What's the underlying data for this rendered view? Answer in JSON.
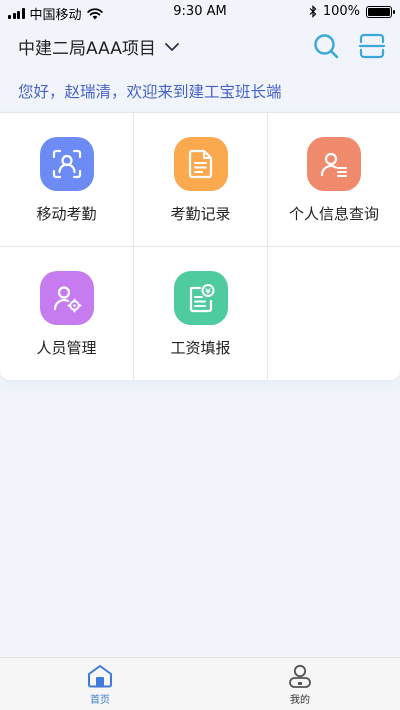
{
  "status_bar": {
    "carrier": "中国移动",
    "time": "9:30 AM",
    "battery": "100%"
  },
  "header": {
    "project": "中建二局AAA项目",
    "icons": [
      "search-icon",
      "scan-icon",
      "chevron-down-icon"
    ]
  },
  "greeting": "您好，赵瑞清，欢迎来到建工宝班长端",
  "menu": [
    {
      "label": "移动考勤",
      "icon": "face-scan-icon",
      "color": "#6d8bf4"
    },
    {
      "label": "考勤记录",
      "icon": "document-icon",
      "color": "#fba94e"
    },
    {
      "label": "个人信息查询",
      "icon": "person-list-icon",
      "color": "#f08a6d"
    },
    {
      "label": "人员管理",
      "icon": "person-gear-icon",
      "color": "#c67cef"
    },
    {
      "label": "工资填报",
      "icon": "salary-form-icon",
      "color": "#4fcba0"
    }
  ],
  "tabbar": {
    "home": "首页",
    "mine": "我的",
    "active_color": "#3f7bd8"
  }
}
